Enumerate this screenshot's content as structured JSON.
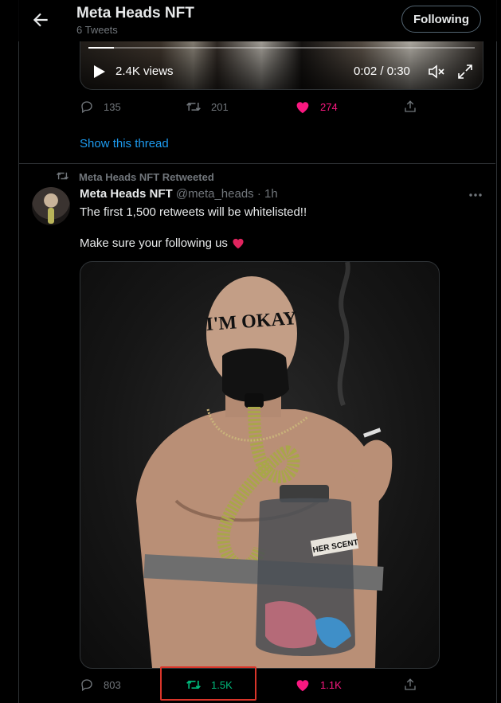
{
  "header": {
    "title": "Meta Heads NFT",
    "subtitle": "6 Tweets",
    "follow_label": "Following"
  },
  "video": {
    "views": "2.4K views",
    "time": "0:02 / 0:30",
    "progress": 0.067
  },
  "tweet1": {
    "replies": "135",
    "retweets": "201",
    "likes": "274",
    "show_thread": "Show this thread"
  },
  "tweet2": {
    "retweeted_by": "Meta Heads NFT Retweeted",
    "name": "Meta Heads NFT",
    "handle": "@meta_heads",
    "time": "1h",
    "text1": "The first 1,500 retweets will be whitelisted!!",
    "text2": "Make sure your following us",
    "image_forehead_text": "I'M OKAY",
    "image_label_text": "HER SCENT",
    "replies": "803",
    "retweets": "1.5K",
    "likes": "1.1K"
  },
  "colors": {
    "accent": "#1d9bf0",
    "retweet_green": "#00ba7c",
    "like_pink": "#f91880",
    "highlight_red": "#d9352a"
  }
}
